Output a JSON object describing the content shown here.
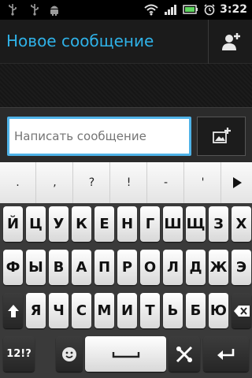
{
  "status_bar": {
    "time": "3:22",
    "icons": [
      "usb-icon",
      "usb-icon",
      "android-debug-icon",
      "wifi-icon",
      "signal-icon",
      "battery-icon",
      "alarm-icon"
    ]
  },
  "header": {
    "title": "Новое сообщение",
    "add_contact_icon": "add-contact-icon"
  },
  "compose": {
    "placeholder": "Написать сообщение",
    "attach_icon": "attach-picture-icon"
  },
  "keyboard": {
    "suggestions": [
      ".",
      ",",
      "?",
      "!",
      "-",
      "'"
    ],
    "row1": [
      "Й",
      "Ц",
      "У",
      "К",
      "Е",
      "Н",
      "Г",
      "Ш",
      "Щ",
      "З",
      "Х"
    ],
    "row2": [
      "Ф",
      "Ы",
      "В",
      "А",
      "П",
      "Р",
      "О",
      "Л",
      "Д",
      "Ж",
      "Э"
    ],
    "row3": [
      "Я",
      "Ч",
      "С",
      "М",
      "И",
      "Т",
      "Ь",
      "Б",
      "Ю"
    ],
    "symbols_key": "12!?",
    "shift_icon": "shift-icon",
    "backspace_icon": "backspace-icon",
    "emoji_icon": "smiley-icon",
    "space_icon": "space-icon",
    "settings_icon": "tools-icon",
    "enter_icon": "enter-icon"
  },
  "colors": {
    "accent": "#2fb2e8",
    "input_focus": "#4fb3e8"
  }
}
